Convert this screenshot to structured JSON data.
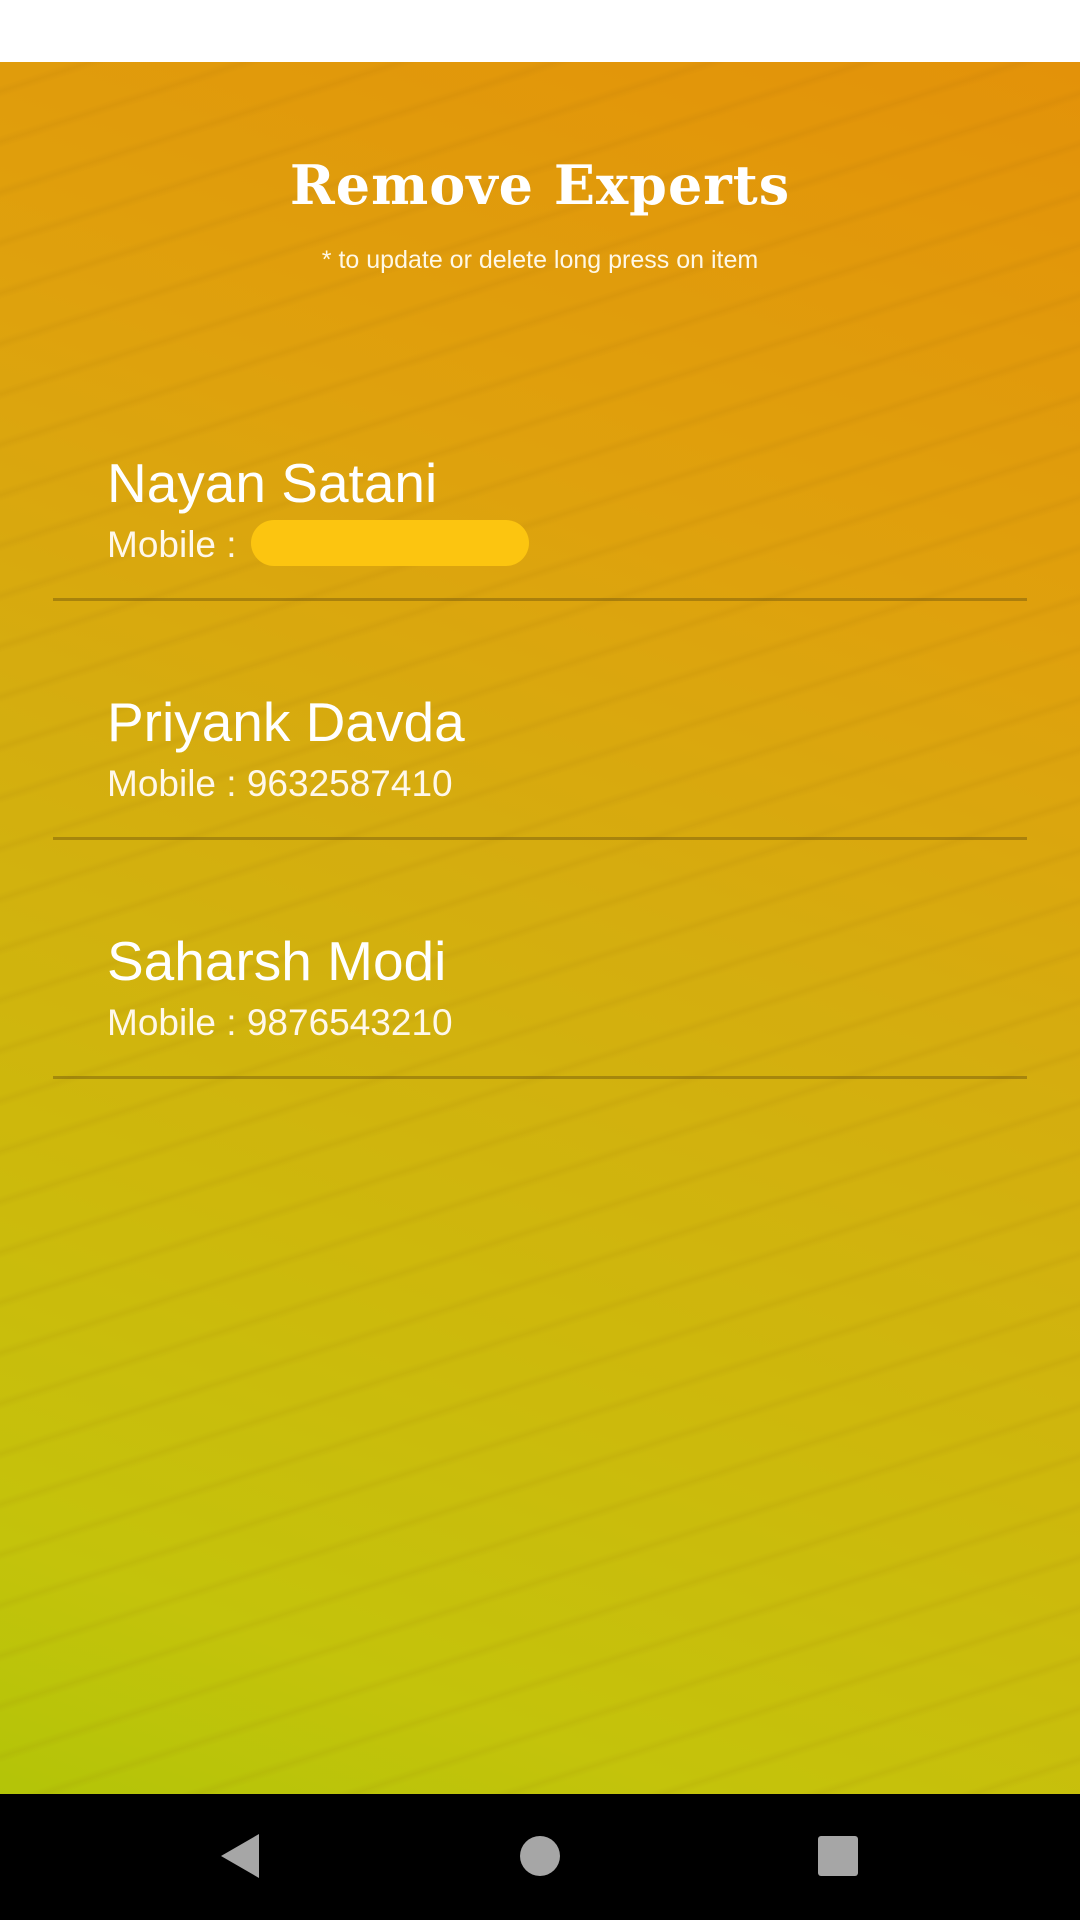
{
  "screen": {
    "title": "Remove Experts",
    "hint": "* to update or delete long press on item"
  },
  "experts": [
    {
      "name": "Nayan Satani",
      "mobile_label": "Mobile : ",
      "mobile": "",
      "mobile_redacted": true
    },
    {
      "name": "Priyank Davda",
      "mobile_label": "Mobile : ",
      "mobile": "9632587410",
      "mobile_redacted": false
    },
    {
      "name": "Saharsh Modi",
      "mobile_label": "Mobile : ",
      "mobile": "9876543210",
      "mobile_redacted": false
    }
  ],
  "nav": {
    "back_icon": "back-icon",
    "home_icon": "home-icon",
    "recents_icon": "recents-icon"
  },
  "colors": {
    "gradient_top": "#e39209",
    "gradient_bottom": "#b3c408",
    "redaction": "#fcc510",
    "nav_bar": "#000000"
  }
}
